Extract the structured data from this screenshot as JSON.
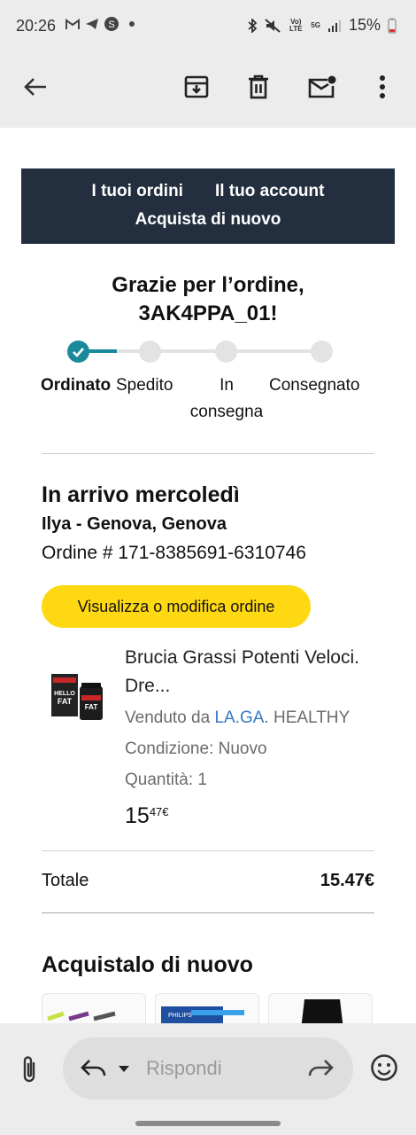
{
  "status_bar": {
    "time": "20:26",
    "signal_labels": [
      "Vo) LTE",
      "5G"
    ],
    "battery": "15%"
  },
  "toolbar": {
    "icons": [
      "back-arrow-icon",
      "archive-icon",
      "delete-icon",
      "mark-unread-icon",
      "more-vert-icon"
    ]
  },
  "email": {
    "banner": {
      "links": [
        "I tuoi ordini",
        "Il tuo account"
      ],
      "buy_again_link": "Acquista di nuovo"
    },
    "thanks_line1": "Grazie per l’ordine,",
    "thanks_line2": "3AK4PPA_01!",
    "progress": {
      "steps": [
        "Ordinato",
        "Spedito",
        "In consegna",
        "Consegnato"
      ],
      "current_step": 1,
      "step3_line1": "In",
      "step3_line2": "consegna",
      "accent_color": "#1a8a9a"
    },
    "arrival_title": "In arrivo mercoledì",
    "address": "Ilya - Genova, Genova",
    "order_number": "Ordine # 171-8385691-6310746",
    "view_button": "Visualizza o modifica ordine",
    "product": {
      "name": "Brucia Grassi Potenti Veloci. Dre...",
      "sold_by_prefix": "Venduto da ",
      "seller_link": "LA.GA",
      "seller_suffix": ". HEALTHY",
      "condition": "Condizione: Nuovo",
      "quantity": "Quantità: 1",
      "price_whole": "15",
      "price_fraction": "47€",
      "image_label": "HELLO FAT"
    },
    "total_label": "Totale",
    "total_value": "15.47€",
    "buy_again_title": "Acquistalo di nuovo",
    "thumb_brand": "PHILIPS"
  },
  "composer": {
    "placeholder": "Rispondi"
  },
  "colors": {
    "banner_bg": "#232f3e",
    "button_yellow": "#ffd814",
    "link_blue": "#3578c3"
  }
}
